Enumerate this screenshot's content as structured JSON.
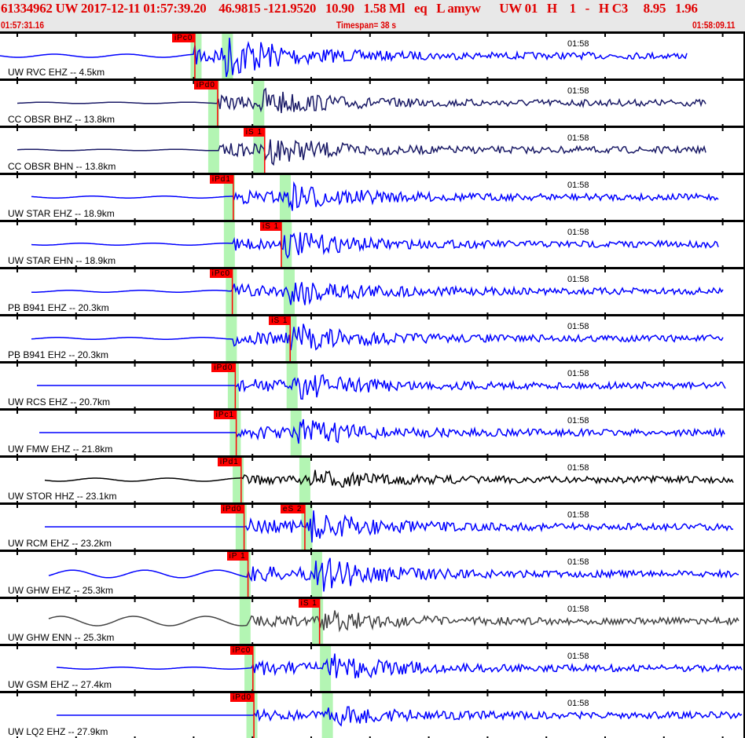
{
  "header": {
    "event_line": "61334962 UW 2017-12-11 01:57:39.20    46.9815 -121.9520   10.90   1.58 Ml   eq   L amyw      UW 01   H    1   -   H C3     8.95   1.96",
    "start_time": "01:57:31.16",
    "timespan": "Timespan=  38 s",
    "end_time": "01:58:09.11"
  },
  "timespan_seconds": 38,
  "minute_label": "01:58",
  "colors": {
    "pick": "#ff0000",
    "band": "#b3f5b3",
    "blue": "#0000ff",
    "navy": "#1a1a66",
    "black": "#000000",
    "gray": "#444444"
  },
  "traces": [
    {
      "label": "UW RVC EHZ -- 4.5km",
      "color": "blue",
      "start": 0.0,
      "end": 35.1,
      "p_band": 10.0,
      "s_band": 11.6,
      "picks": [
        {
          "label": "iPc0",
          "t": 9.94
        }
      ],
      "p": 9.94,
      "s": 11.5,
      "amp": 1.0,
      "noise": 0.05
    },
    {
      "label": "CC OBSR BHZ -- 13.8km",
      "color": "navy",
      "start": 0.9,
      "end": 36.0,
      "p_band": 10.9,
      "s_band": 13.2,
      "picks": [
        {
          "label": "iPd0",
          "t": 11.1
        }
      ],
      "p": 11.1,
      "s": 13.3,
      "amp": 0.6,
      "noise": 0.02
    },
    {
      "label": "CC OBSR BHN -- 13.8km",
      "color": "navy",
      "start": 0.9,
      "end": 36.0,
      "p_band": 10.9,
      "s_band": 13.2,
      "picks": [
        {
          "label": "iS 1",
          "t": 13.5
        }
      ],
      "p": 11.2,
      "s": 13.5,
      "amp": 0.6,
      "noise": 0.02
    },
    {
      "label": "UW STAR EHZ -- 18.9km",
      "color": "blue",
      "start": 1.6,
      "end": 36.7,
      "p_band": 11.7,
      "s_band": 14.55,
      "picks": [
        {
          "label": "iPd1",
          "t": 11.9
        }
      ],
      "p": 11.9,
      "s": 14.6,
      "amp": 0.6,
      "noise": 0.03
    },
    {
      "label": "UW STAR EHN -- 18.9km",
      "color": "blue",
      "start": 1.6,
      "end": 36.7,
      "p_band": 11.7,
      "s_band": 14.6,
      "picks": [
        {
          "label": "iS 1",
          "t": 14.35
        }
      ],
      "p": 11.9,
      "s": 14.5,
      "amp": 0.55,
      "noise": 0.03
    },
    {
      "label": "PB B941 EHZ -- 20.3km",
      "color": "blue",
      "start": 1.6,
      "end": 36.9,
      "p_band": 11.8,
      "s_band": 14.75,
      "picks": [
        {
          "label": "iPc0",
          "t": 11.85
        }
      ],
      "p": 11.85,
      "s": 14.8,
      "amp": 0.65,
      "noise": 0.03
    },
    {
      "label": "PB B941 EH2 -- 20.3km",
      "color": "blue",
      "start": 1.6,
      "end": 36.9,
      "p_band": 11.8,
      "s_band": 14.85,
      "picks": [
        {
          "label": "iS 1",
          "t": 14.8
        }
      ],
      "p": 11.9,
      "s": 14.8,
      "amp": 0.65,
      "noise": 0.03
    },
    {
      "label": "UW RCS EHZ -- 20.7km",
      "color": "blue",
      "start": 1.9,
      "end": 37.0,
      "p_band": 11.9,
      "s_band": 14.9,
      "picks": [
        {
          "label": "iPd0",
          "t": 12.0
        }
      ],
      "p": 12.0,
      "s": 14.9,
      "amp": 0.6,
      "noise": 0.0
    },
    {
      "label": "UW FMW EHZ -- 21.8km",
      "color": "blue",
      "start": 2.0,
      "end": 37.0,
      "p_band": 12.0,
      "s_band": 15.1,
      "picks": [
        {
          "label": "iPc1",
          "t": 12.05
        }
      ],
      "p": 12.05,
      "s": 15.1,
      "amp": 0.6,
      "noise": 0.0
    },
    {
      "label": "UW STOR HHZ -- 23.1km",
      "color": "black",
      "start": 2.3,
      "end": 37.4,
      "p_band": 12.15,
      "s_band": 15.55,
      "picks": [
        {
          "label": "iPd1",
          "t": 12.3
        }
      ],
      "p": 12.3,
      "s": 15.8,
      "amp": 0.35,
      "noise": 0.05
    },
    {
      "label": "UW RCM EHZ -- 23.2km",
      "color": "blue",
      "start": 2.3,
      "end": 37.4,
      "p_band": 12.3,
      "s_band": 15.65,
      "picks": [
        {
          "label": "iPd0",
          "t": 12.45
        },
        {
          "label": "eS 2",
          "t": 15.55
        }
      ],
      "p": 12.5,
      "s": 15.6,
      "amp": 0.7,
      "noise": 0.0
    },
    {
      "label": "UW GHW EHZ -- 25.3km",
      "color": "blue",
      "start": 2.5,
      "end": 37.7,
      "p_band": 12.5,
      "s_band": 16.15,
      "picks": [
        {
          "label": "iP 1",
          "t": 12.65
        }
      ],
      "p": 12.65,
      "s": 16.1,
      "amp": 0.75,
      "noise": 0.12
    },
    {
      "label": "UW GHW ENN -- 25.3km",
      "color": "gray",
      "start": 2.5,
      "end": 37.7,
      "p_band": 12.5,
      "s_band": 16.2,
      "picks": [
        {
          "label": "iS 1",
          "t": 16.3
        }
      ],
      "p": 12.6,
      "s": 16.3,
      "amp": 0.45,
      "noise": 0.15
    },
    {
      "label": "UW GSM EHZ -- 27.4km",
      "color": "blue",
      "start": 2.9,
      "end": 37.9,
      "p_band": 12.75,
      "s_band": 16.6,
      "picks": [
        {
          "label": "iPc0",
          "t": 12.9
        }
      ],
      "p": 12.9,
      "s": 16.6,
      "amp": 0.6,
      "noise": 0.03
    },
    {
      "label": "UW LQ2 EHZ -- 27.9km",
      "color": "blue",
      "start": 2.9,
      "end": 37.9,
      "p_band": 12.85,
      "s_band": 16.7,
      "picks": [
        {
          "label": "iPd0",
          "t": 12.95
        }
      ],
      "p": 12.95,
      "s": 16.7,
      "amp": 0.4,
      "noise": 0.0
    }
  ]
}
